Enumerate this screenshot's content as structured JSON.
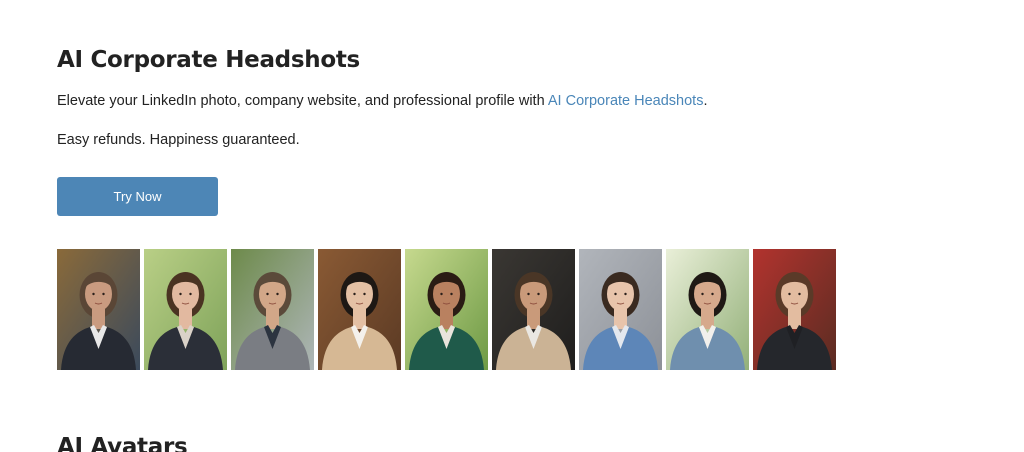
{
  "headshots": {
    "title": "AI Corporate Headshots",
    "description_prefix": "Elevate your LinkedIn photo, company website, and professional profile with ",
    "description_link": "AI Corporate Headshots",
    "description_suffix": ".",
    "guarantee": "Easy refunds. Happiness guaranteed.",
    "cta_label": "Try Now",
    "accent_color": "#4d86b6",
    "link_color": "#4a86b8",
    "photos": [
      {
        "name": "photo-man-dark-suit-city-night",
        "bg": "#3b4a5c",
        "bg2": "#8a6a3a",
        "skin": "#c99b80",
        "hair": "#5a4636",
        "suit": "#262a33",
        "shirt": "#e8e8e8"
      },
      {
        "name": "photo-woman-dark-blazer-garden",
        "bg": "#7fa35a",
        "bg2": "#b9cf86",
        "skin": "#e2b9a0",
        "hair": "#4a3322",
        "suit": "#2b2f38",
        "shirt": "#dad2c8"
      },
      {
        "name": "photo-man-grey-blazer-house",
        "bg": "#aeb6b8",
        "bg2": "#6d8a4a",
        "skin": "#d2a788",
        "hair": "#5b4a3a",
        "suit": "#7a7d83",
        "shirt": "#2c3440"
      },
      {
        "name": "photo-man-tan-tuxedo-bookshelf",
        "bg": "#5b3a24",
        "bg2": "#8a5a34",
        "skin": "#e4c0a4",
        "hair": "#1e1814",
        "suit": "#d6b894",
        "shirt": "#f4f1ec"
      },
      {
        "name": "photo-woman-green-blazer-park",
        "bg": "#6e9a45",
        "bg2": "#c6d98e",
        "skin": "#b98160",
        "hair": "#2a1c14",
        "suit": "#1f5a4a",
        "shirt": "#e9e4dc"
      },
      {
        "name": "photo-man-beige-blazer-dark-studio",
        "bg": "#1f1e1d",
        "bg2": "#3a3733",
        "skin": "#c99a7a",
        "hair": "#4a3626",
        "suit": "#cbb395",
        "shirt": "#eae7e2"
      },
      {
        "name": "photo-woman-blue-blazer-grey-studio",
        "bg": "#8d9198",
        "bg2": "#b1b5bb",
        "skin": "#e8c4ab",
        "hair": "#3a2a20",
        "suit": "#5d86b8",
        "shirt": "#e4e8ee"
      },
      {
        "name": "photo-woman-denim-jacket-sunny-trees",
        "bg": "#93b079",
        "bg2": "#e9efd8",
        "skin": "#d6a98c",
        "hair": "#1f1915",
        "suit": "#6f8fae",
        "shirt": "#f2f0ec"
      },
      {
        "name": "photo-woman-black-blazer-red-backdrop",
        "bg": "#5a2c22",
        "bg2": "#b2332e",
        "skin": "#e3bca0",
        "hair": "#5a3a28",
        "suit": "#25272c",
        "shirt": "#1f2024"
      }
    ]
  },
  "avatars": {
    "title": "AI Avatars"
  }
}
